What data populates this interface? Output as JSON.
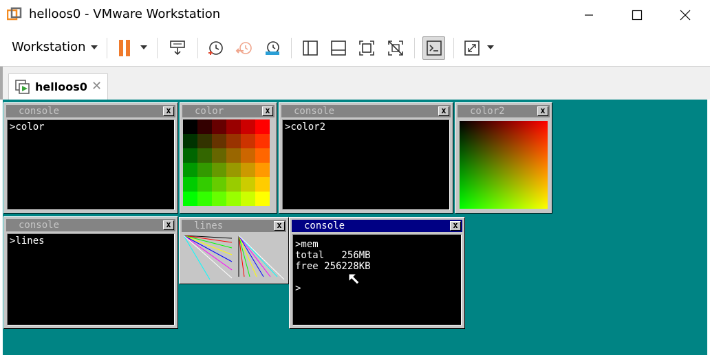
{
  "window": {
    "title": "helloos0 - VMware Workstation",
    "icon": "vmware-logo-icon"
  },
  "toolbar": {
    "menu_label": "Workstation"
  },
  "tab": {
    "label": "helloos0",
    "icon": "vm-play-icon",
    "close_glyph": "✕"
  },
  "colors": {
    "desktop": "#008484",
    "window_face": "#c6c6c6",
    "inactive_title": "#848484",
    "active_title": "#000084",
    "pause_orange": "#f07a2b"
  },
  "guest": {
    "windows": [
      {
        "title": "console",
        "lines": [
          ">color"
        ]
      },
      {
        "title": "color"
      },
      {
        "title": "console",
        "lines": [
          ">color2"
        ]
      },
      {
        "title": "color2"
      },
      {
        "title": "console",
        "lines": [
          ">lines"
        ]
      },
      {
        "title": "lines"
      },
      {
        "title": "console",
        "lines": [
          ">mem",
          "total   256MB",
          "free 256228KB",
          "",
          ">"
        ]
      }
    ],
    "close_glyph": "x"
  }
}
